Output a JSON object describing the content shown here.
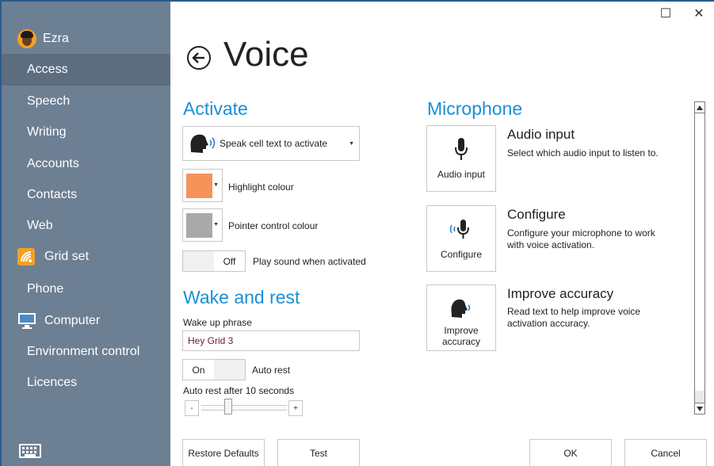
{
  "window": {
    "maximize_glyph": "☐",
    "close_glyph": "✕"
  },
  "user": {
    "name": "Ezra",
    "avatar_icon": "avatar-icon"
  },
  "sidebar": {
    "items": [
      {
        "label": "Access",
        "active": true
      },
      {
        "label": "Speech"
      },
      {
        "label": "Writing"
      },
      {
        "label": "Accounts"
      },
      {
        "label": "Contacts"
      },
      {
        "label": "Web"
      },
      {
        "label": "Grid set",
        "icon": "grid-set-icon"
      },
      {
        "label": "Phone"
      },
      {
        "label": "Computer",
        "icon": "computer-icon"
      },
      {
        "label": "Environment control"
      },
      {
        "label": "Licences"
      }
    ],
    "keyboard_icon": "keyboard-icon"
  },
  "page": {
    "title": "Voice",
    "back_icon": "back-arrow-icon"
  },
  "activate": {
    "heading": "Activate",
    "mode_dropdown": {
      "selected": "Speak cell text to activate"
    },
    "highlight": {
      "label": "Highlight colour",
      "color": "#f5935a"
    },
    "pointer": {
      "label": "Pointer control colour",
      "color": "#a9a9a9"
    },
    "play_sound": {
      "state": "Off",
      "label": "Play sound when activated"
    }
  },
  "wake": {
    "heading": "Wake and rest",
    "phrase_label": "Wake up phrase",
    "phrase_value": "Hey Grid 3",
    "auto_rest": {
      "state": "On",
      "label": "Auto rest"
    },
    "auto_rest_after": "Auto rest after 10 seconds",
    "slider": {
      "minus": "-",
      "plus": "+",
      "level": 0.3
    }
  },
  "microphone": {
    "heading": "Microphone",
    "items": [
      {
        "button_label": "Audio input",
        "title": "Audio input",
        "desc": "Select which audio input to listen to.",
        "icon": "microphone-icon"
      },
      {
        "button_label": "Configure",
        "title": "Configure",
        "desc": "Configure your microphone to work with voice activation.",
        "icon": "microphone-waves-icon"
      },
      {
        "button_label": "Improve accuracy",
        "title": "Improve accuracy",
        "desc": "Read text to help improve voice activation accuracy.",
        "icon": "speaking-head-icon"
      }
    ]
  },
  "footer": {
    "restore": "Restore Defaults",
    "test": "Test",
    "ok": "OK",
    "cancel": "Cancel"
  },
  "colors": {
    "sidebar_bg": "#6d7f93",
    "sidebar_active": "#5c6d80",
    "accent": "#1a8fd6",
    "brand_orange": "#f2a125"
  }
}
